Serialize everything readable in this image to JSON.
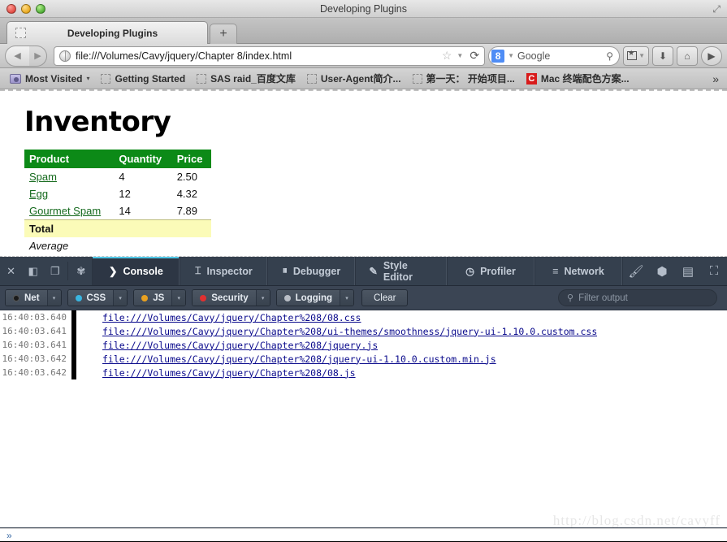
{
  "window": {
    "title": "Developing Plugins",
    "traffic_lights": [
      "close-red",
      "minimize-yellow",
      "zoom-green"
    ],
    "fullscreen_glyph": "⤢"
  },
  "tabs": {
    "items": [
      {
        "label": "Developing Plugins",
        "favicon": "placeholder-favicon"
      }
    ],
    "new_tab_label": "+"
  },
  "navbar": {
    "back_glyph": "◀",
    "forward_glyph": "▶",
    "url": "file:///Volumes/Cavy/jquery/Chapter 8/index.html",
    "star_glyph": "☆",
    "caret_glyph": "▼",
    "reload_glyph": "⟳",
    "search": {
      "engine_logo": "8",
      "engine_caret": "▼",
      "placeholder": "Google",
      "value": "Google",
      "magnifier": "🔍"
    },
    "buttons": [
      {
        "name": "bookmarks-menu",
        "glyph": "▼"
      },
      {
        "name": "downloads",
        "glyph": "⬇"
      },
      {
        "name": "home",
        "glyph": "⌂"
      },
      {
        "name": "sync",
        "glyph": "▶"
      }
    ]
  },
  "bookmarks": {
    "items": [
      {
        "label": "Most Visited",
        "icon": "folder-icon",
        "dropdown": "▾"
      },
      {
        "label": "Getting Started",
        "icon": "placeholder-icon"
      },
      {
        "label": "SAS raid_百度文库",
        "icon": "placeholder-icon"
      },
      {
        "label": "User-Agent简介...",
        "icon": "placeholder-icon"
      },
      {
        "label": "第一天： 开始项目...",
        "icon": "placeholder-icon"
      },
      {
        "label": "Mac 终端配色方案...",
        "icon": "csdn-c-icon"
      }
    ],
    "overflow_glyph": "»"
  },
  "page": {
    "heading": "Inventory",
    "table": {
      "columns": [
        "Product",
        "Quantity",
        "Price"
      ],
      "rows": [
        {
          "product": "Spam",
          "quantity": "4",
          "price": "2.50"
        },
        {
          "product": "Egg",
          "quantity": "12",
          "price": "4.32"
        },
        {
          "product": "Gourmet Spam",
          "quantity": "14",
          "price": "7.89"
        }
      ],
      "total_label": "Total",
      "total_quantity": "",
      "total_price": "",
      "average_label": "Average",
      "average_quantity": "",
      "average_price": "",
      "header_bg": "#0c8a17",
      "total_bg": "#fbfbb8",
      "link_color": "#14691c"
    }
  },
  "devtools": {
    "left_icons": [
      {
        "name": "close-devtools-icon",
        "glyph": "✕"
      },
      {
        "name": "dock-side-icon",
        "glyph": "◧"
      },
      {
        "name": "detach-window-icon",
        "glyph": "❐"
      },
      {
        "name": "settings-gear-icon",
        "glyph": "✾"
      }
    ],
    "tabs": [
      {
        "label": "Console",
        "icon": "chevron-right-icon",
        "glyph": "❯",
        "active": true
      },
      {
        "label": "Inspector",
        "icon": "inspector-icon",
        "glyph": "⌶",
        "active": false
      },
      {
        "label": "Debugger",
        "icon": "pause-circle-icon",
        "glyph": "⏸",
        "active": false
      },
      {
        "label": "Style Editor",
        "icon": "pencil-square-icon",
        "glyph": "✎",
        "active": false
      },
      {
        "label": "Profiler",
        "icon": "clock-icon",
        "glyph": "◷",
        "active": false
      },
      {
        "label": "Network",
        "icon": "network-bars-icon",
        "glyph": "≡",
        "active": false
      }
    ],
    "right_icons": [
      {
        "name": "paint-brush-icon",
        "glyph": "🖌"
      },
      {
        "name": "3d-view-cube-icon",
        "glyph": "⬢"
      },
      {
        "name": "scratchpad-icon",
        "glyph": "▤"
      },
      {
        "name": "responsive-design-icon",
        "glyph": "⛶"
      }
    ],
    "filters": [
      {
        "label": "Net",
        "dot": "#1a1a1a",
        "arrow": "▾"
      },
      {
        "label": "CSS",
        "dot": "#3ab5e0",
        "arrow": "▾"
      },
      {
        "label": "JS",
        "dot": "#e8a020",
        "arrow": "▾"
      },
      {
        "label": "Security",
        "dot": "#e03030",
        "arrow": "▾"
      },
      {
        "label": "Logging",
        "dot": "#b9bec6",
        "arrow": "▾"
      }
    ],
    "clear_label": "Clear",
    "filter_output": {
      "placeholder": "Filter output",
      "magnifier": "🔍"
    },
    "log": [
      {
        "time": "16:40:03.640",
        "message": "file:///Volumes/Cavy/jquery/Chapter%208/08.css"
      },
      {
        "time": "16:40:03.641",
        "message": "file:///Volumes/Cavy/jquery/Chapter%208/ui-themes/smoothness/jquery-ui-1.10.0.custom.css"
      },
      {
        "time": "16:40:03.641",
        "message": "file:///Volumes/Cavy/jquery/Chapter%208/jquery.js"
      },
      {
        "time": "16:40:03.642",
        "message": "file:///Volumes/Cavy/jquery/Chapter%208/jquery-ui-1.10.0.custom.min.js"
      },
      {
        "time": "16:40:03.642",
        "message": "file:///Volumes/Cavy/jquery/Chapter%208/08.js"
      }
    ],
    "watermark": "http://blog.csdn.net/cavyff"
  },
  "statusbar": {
    "chevron": "»"
  }
}
